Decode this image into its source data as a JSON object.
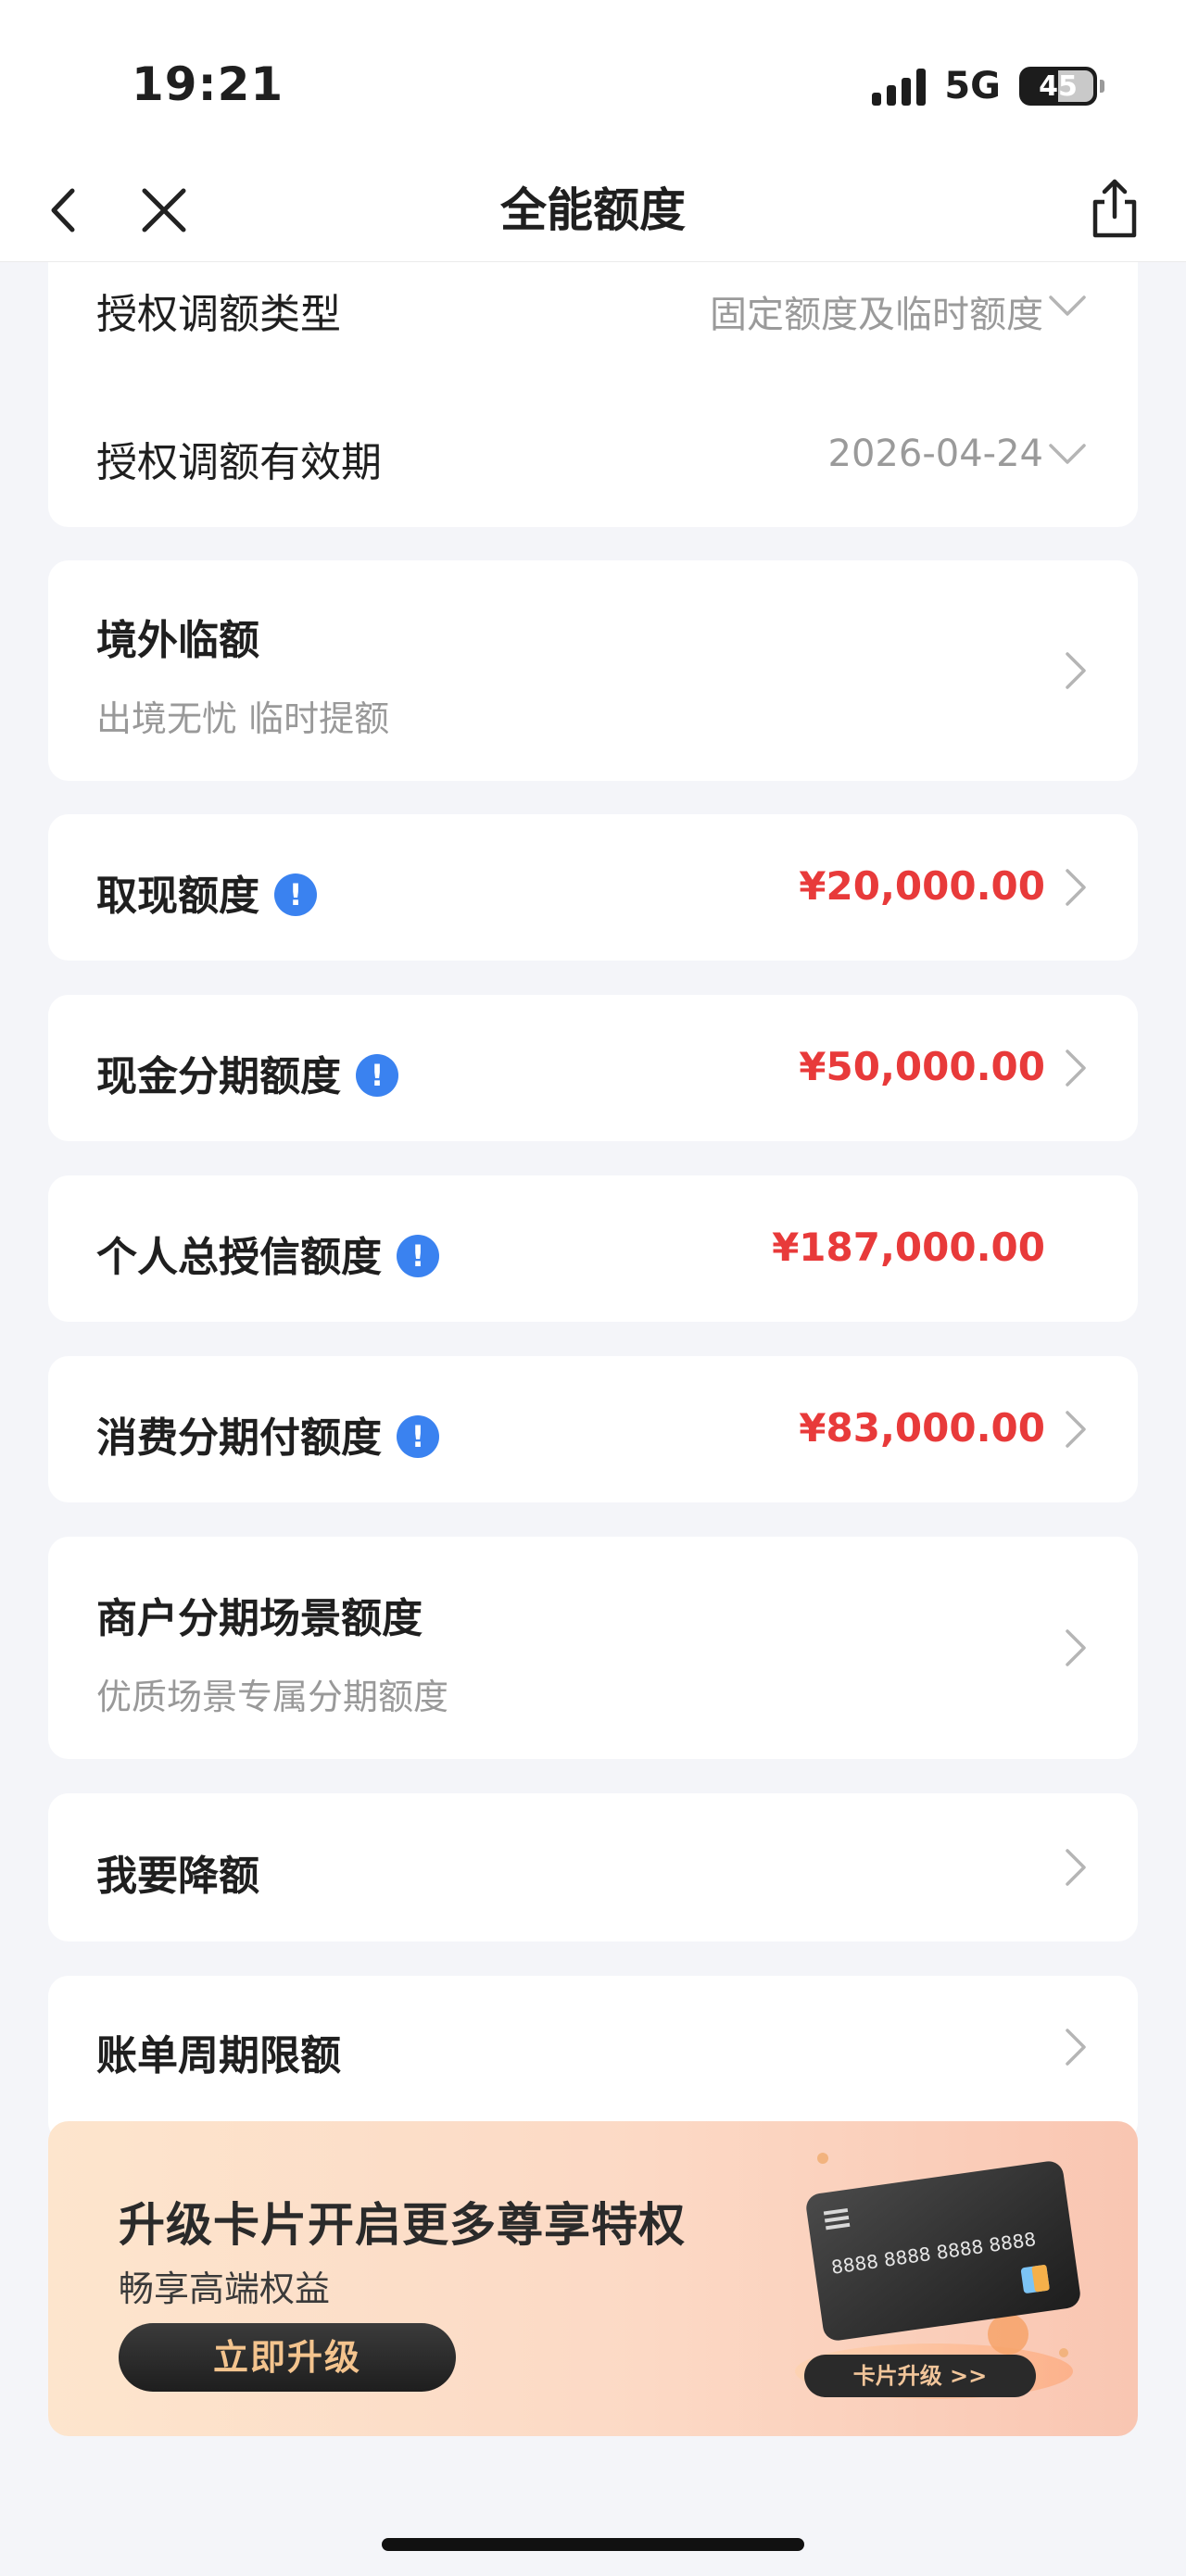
{
  "status": {
    "time": "19:21",
    "network": "5G",
    "battery": "45"
  },
  "nav": {
    "title": "全能额度"
  },
  "auth": {
    "type_label": "授权调额类型",
    "type_value": "固定额度及临时额度",
    "validity_label": "授权调额有效期",
    "validity_value": "2026-04-24"
  },
  "overseas": {
    "title": "境外临额",
    "subtitle": "出境无忧 临时提额"
  },
  "cash": {
    "title": "取现额度",
    "amount": "¥20,000.00"
  },
  "installment": {
    "title": "现金分期额度",
    "amount": "¥50,000.00"
  },
  "total": {
    "title": "个人总授信额度",
    "amount": "¥187,000.00"
  },
  "consume": {
    "title": "消费分期付额度",
    "amount": "¥83,000.00"
  },
  "merchant": {
    "title": "商户分期场景额度",
    "subtitle": "优质场景专属分期额度"
  },
  "reduce": {
    "title": "我要降额"
  },
  "billing": {
    "title": "账单周期限额"
  },
  "promo": {
    "title": "升级卡片开启更多尊享特权",
    "subtitle": "畅享高端权益",
    "button": "立即升级",
    "card_number": "8888 8888 8888 8888",
    "card_tag": "卡片升级 >>"
  },
  "colors": {
    "amount": "#e83a3a",
    "info": "#3a82f0",
    "background": "#f4f5f9"
  },
  "icons": [
    "back-icon",
    "close-icon",
    "share-icon",
    "chevron-down-icon",
    "chevron-right-icon",
    "info-icon"
  ]
}
